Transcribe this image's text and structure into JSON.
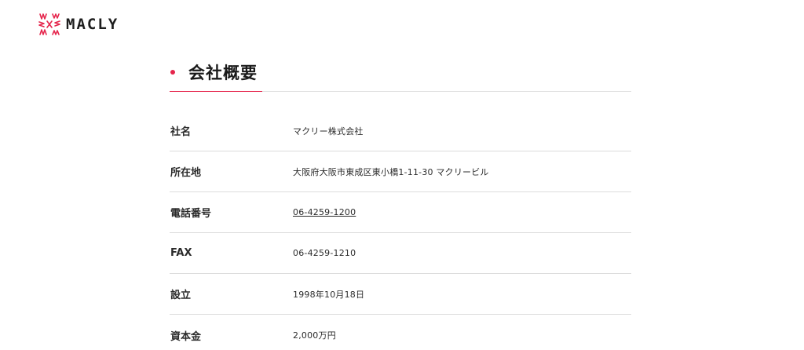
{
  "header": {
    "logo_text": "MACLY",
    "logo_icon": "macly-logo-mark",
    "accent_color": "#e5254c"
  },
  "section": {
    "title": "会社概要"
  },
  "company_info": [
    {
      "label": "社名",
      "value": "マクリー株式会社",
      "is_link": false
    },
    {
      "label": "所在地",
      "value": "大阪府大阪市東成区東小橋1-11-30 マクリービル",
      "is_link": false
    },
    {
      "label": "電話番号",
      "value": "06-4259-1200",
      "is_link": true
    },
    {
      "label": "FAX",
      "value": "06-4259-1210",
      "is_link": false
    },
    {
      "label": "設立",
      "value": "1998年10月18日",
      "is_link": false
    },
    {
      "label": "資本金",
      "value": "2,000万円",
      "is_link": false
    }
  ]
}
